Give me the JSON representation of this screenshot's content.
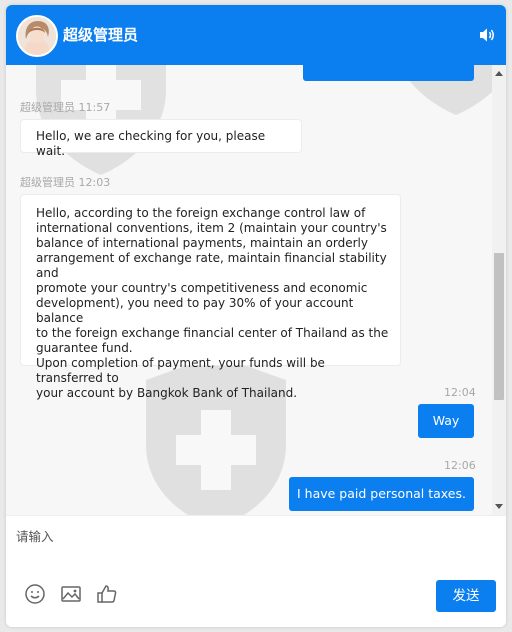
{
  "header": {
    "title": "超级管理员"
  },
  "messages": [
    {
      "sender": "超级管理员",
      "time": "11:57",
      "text": "Hello, we are checking for you, please wait."
    },
    {
      "sender": "超级管理员",
      "time": "12:03",
      "lines": [
        "Hello, according to the foreign exchange control law of",
        "international conventions, item 2 (maintain your country's",
        "balance of international payments, maintain an orderly",
        "arrangement of exchange rate, maintain financial stability and",
        "promote your country's competitiveness and economic",
        "development), you need to pay 30% of your account balance",
        "to the foreign exchange financial center of Thailand as the",
        "guarantee fund.",
        "Upon completion of payment, your funds will be transferred to",
        "your account by Bangkok Bank of Thailand."
      ]
    },
    {
      "time": "12:04",
      "text": "Way"
    },
    {
      "time": "12:06",
      "text": "I have paid personal taxes."
    }
  ],
  "input": {
    "placeholder": "请输入"
  },
  "toolbar": {
    "emoji_icon": "smiley-icon",
    "image_icon": "image-icon",
    "like_icon": "thumbs-up-icon",
    "send_label": "发送"
  },
  "colors": {
    "accent": "#0b7ef0",
    "background": "#f7f7f7"
  }
}
